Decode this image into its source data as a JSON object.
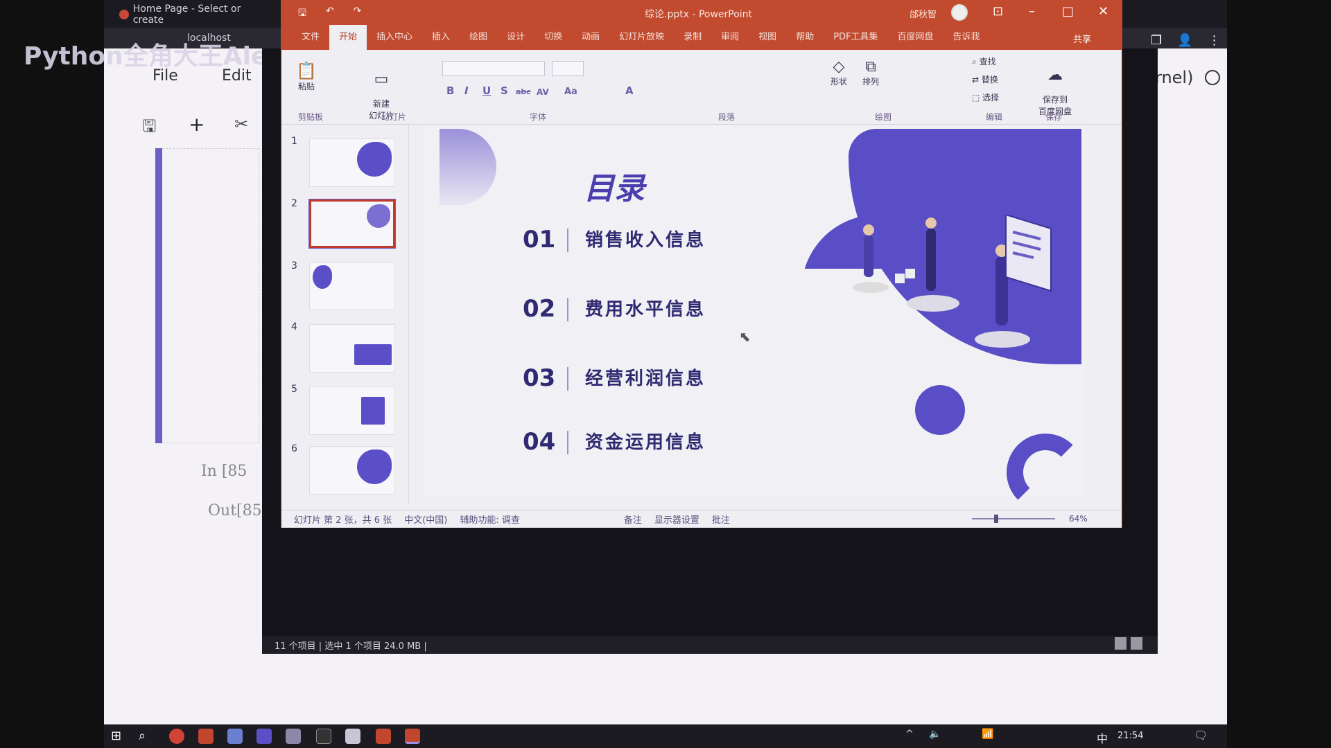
{
  "browser": {
    "tab_title": "Home Page - Select or create",
    "address": "localhost"
  },
  "watermark": "Python全角大王Alex",
  "jupyter": {
    "menu": [
      "File",
      "Edit"
    ],
    "kernel_label": "rnel)",
    "in_prompt": "In [85",
    "out_prompt": "Out[85"
  },
  "explorer": {
    "status": "11 个项目  |  选中 1 个项目  24.0 MB  |"
  },
  "ppt": {
    "filename": "综论.pptx - PowerPoint",
    "account": "邰秋智",
    "share": "共享",
    "tabs": [
      "文件",
      "开始",
      "插入中心",
      "插入",
      "绘图",
      "设计",
      "切换",
      "动画",
      "幻灯片放映",
      "录制",
      "审阅",
      "视图",
      "帮助",
      "PDF工具集",
      "百度网盘",
      "告诉我"
    ],
    "active_tab_index": 1,
    "ribbon_groups": [
      "剪贴板",
      "幻灯片",
      "字体",
      "段落",
      "绘图",
      "编辑",
      "保存"
    ],
    "ribbon_buttons": {
      "paste": "粘贴",
      "new_slide": "新建\n幻灯片",
      "shapes": "形状",
      "arrange": "排列",
      "find": "查找",
      "replace": "替换",
      "select": "选择",
      "save_baidu": "保存到\n百度网盘"
    },
    "format_buttons": [
      "B",
      "I",
      "U",
      "S",
      "abc",
      "AV",
      "Aa",
      "A"
    ],
    "thumbnails": [
      "1",
      "2",
      "3",
      "4",
      "5",
      "6"
    ],
    "selected_slide": 2,
    "slide": {
      "title": "目录",
      "items": [
        {
          "num": "01",
          "label": "销售收入信息"
        },
        {
          "num": "02",
          "label": "费用水平信息"
        },
        {
          "num": "03",
          "label": "经营利润信息"
        },
        {
          "num": "04",
          "label": "资金运用信息"
        }
      ],
      "accent": "#5a4ec6"
    },
    "status": {
      "slide_info": "幻灯片 第 2 张，共 6 张",
      "language": "中文(中国)",
      "accessibility": "辅助功能: 调查",
      "notes": "备注",
      "display": "显示器设置",
      "comments": "批注",
      "zoom": "64%"
    }
  },
  "taskbar": {
    "time": "21:54",
    "ime": "中"
  },
  "colors": {
    "ppt_red": "#c24a2e",
    "purple": "#5a4ec6"
  }
}
